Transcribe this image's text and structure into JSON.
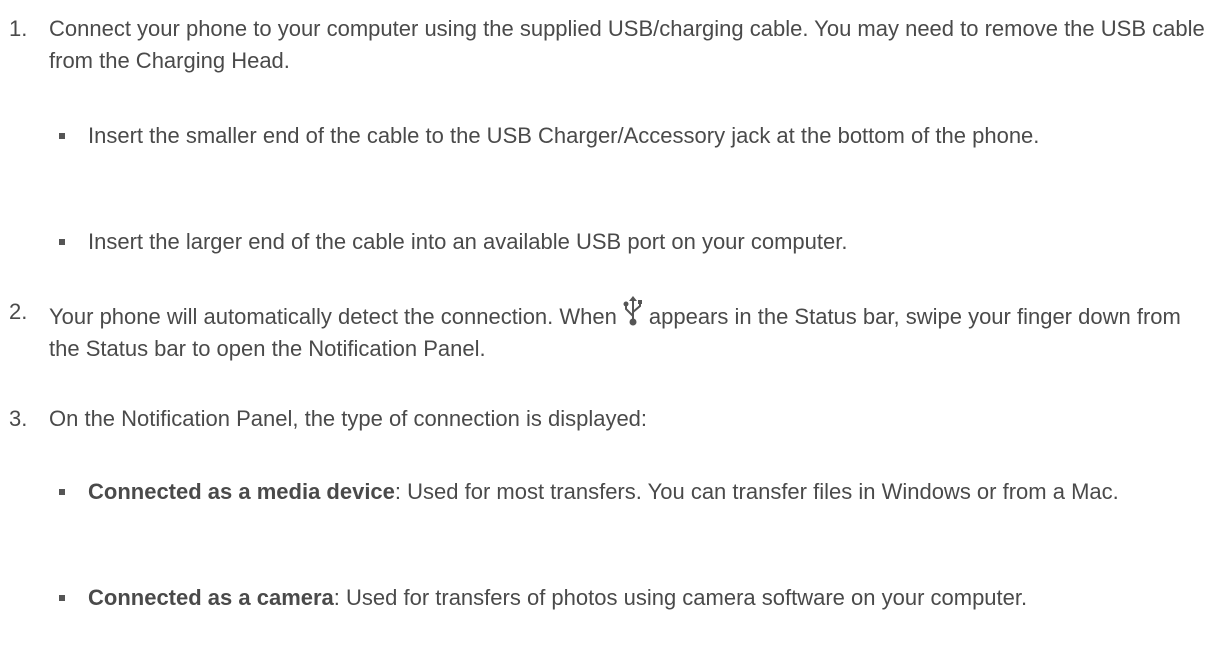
{
  "steps": [
    {
      "number": "1.",
      "text": "Connect your phone to your computer using the supplied USB/charging cable. You may need to remove the USB cable from the Charging Head.",
      "bullets": [
        "Insert the smaller end of the cable to the USB Charger/Accessory jack at the bottom of the phone.",
        "Insert the larger end of the cable into an available USB port on your computer."
      ]
    },
    {
      "number": "2.",
      "text_before_icon": "Your phone will automatically detect the connection. When",
      "icon": "usb-icon",
      "text_after_icon": "appears in the Status bar, swipe your finger down from the Status bar to open the Notification Panel."
    },
    {
      "number": "3.",
      "text": "On the Notification Panel, the type of connection is displayed:",
      "bullets": [
        {
          "term": "Connected as a media device",
          "desc": ": Used for most transfers. You can transfer files in Windows or from a Mac."
        },
        {
          "term": "Connected as a camera",
          "desc": ": Used for transfers of photos using camera software on your computer."
        }
      ]
    }
  ],
  "colors": {
    "text": "#4a4a4a",
    "bullet": "#555555"
  }
}
